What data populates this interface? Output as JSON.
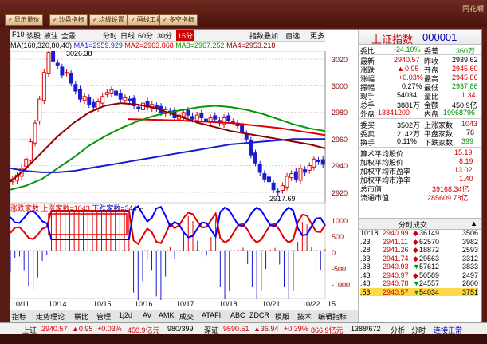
{
  "brand": "同花顺",
  "top_buttons": [
    "显示量价",
    "沙盘指标",
    "均线设置",
    "画线工具",
    "多空指标",
    "大盘对比"
  ],
  "toolbar": {
    "items": [
      "F10",
      "诊股",
      "披注",
      "全景",
      "分时",
      "日线",
      "60分",
      "30分",
      "15分",
      "1分"
    ],
    "active": "15分",
    "right": [
      "指数叠加",
      "自选",
      "更多"
    ]
  },
  "ma_line": {
    "label": "MA",
    "params": "(160,320,80,40)",
    "ma1": "MA1=2959.929",
    "ma2": "MA2=2963.868",
    "ma3": "MA3=2967.252",
    "ma4": "MA4=2953.218"
  },
  "price_axis": [
    "3020",
    "3000",
    "2980",
    "2960",
    "2940",
    "2920"
  ],
  "annotations": {
    "high": "3026.38",
    "low": "2917.69"
  },
  "indicator_label": {
    "name": "涨跌家数",
    "up": "上涨家数=1043",
    "down": "下跌家数=344",
    "dash": "--"
  },
  "indicator_axis": [
    "1000",
    "500",
    "0",
    "-500",
    "-1000"
  ],
  "x_axis": [
    "10/11",
    "10/14",
    "10/15",
    "10/16",
    "10/17",
    "10/18",
    "10/21",
    "10/22"
  ],
  "x_axis_btn": "15分钟",
  "colors": {
    "ma1": "#1a1ad0",
    "ma2": "#e00000",
    "ma3": "#009900",
    "ma4": "#8b0000",
    "up": "#e00000",
    "down": "#0000ff",
    "bg": "#5a1a14"
  },
  "quote": {
    "title": "上证指数",
    "code": "000001",
    "委比": "-24.10%",
    "委差": "1360万",
    "最新": "2940.57",
    "昨收": "2939.62",
    "涨跌": "0.95",
    "开盘": "2945.60",
    "涨幅": "+0.03%",
    "最高": "2945.86",
    "振幅": "0.27%",
    "最低": "2937.86",
    "现手": "54034",
    "量比": "1.34",
    "总手": "3881万",
    "金额": "450.9亿",
    "外盘": "18841200",
    "内盘": "19968796",
    "委买": "3502万",
    "上涨家数": "1043",
    "委卖": "2142万",
    "平盘家数": "76",
    "换手": "0.11%",
    "下跌家数": "399",
    "算术平均股价": "15.19",
    "加权平均股价": "8.19",
    "加权平均市盈率": "13.02",
    "加权平均市净率": "1.40",
    "总市值": "39168.34亿",
    "流通市值": "285609.78亿"
  },
  "tick_head": {
    "title": "分时成交",
    "nav": "▲"
  },
  "ticks": [
    {
      "t": "10:18",
      "p": "2940.99",
      "f": "◆",
      "v1": "36149",
      "v2": "3506"
    },
    {
      "t": ".23",
      "p": "2941.11",
      "f": "◆",
      "v1": "62570",
      "v2": "3982"
    },
    {
      "t": ".28",
      "p": "2941.26",
      "f": "◆",
      "v1": "18872",
      "v2": "2593"
    },
    {
      "t": ".33",
      "p": "2941.74",
      "f": "◆",
      "v1": "29563",
      "v2": "3312"
    },
    {
      "t": ".38",
      "p": "2940.93",
      "f": "▼",
      "v1": "57612",
      "v2": "3833"
    },
    {
      "t": ".43",
      "p": "2940.97",
      "f": "◆",
      "v1": "50589",
      "v2": "2497"
    },
    {
      "t": ".48",
      "p": "2940.78",
      "f": "▼",
      "v1": "24557",
      "v2": "2800"
    },
    {
      "t": ".53",
      "p": "2940.57",
      "f": "▼",
      "v1": "54034",
      "v2": "3751"
    }
  ],
  "rp_bottom": [
    "笔",
    "价",
    "分",
    "多",
    "细"
  ],
  "tabs": [
    "指标",
    "走势理论",
    "横比",
    "管理",
    "1j2d",
    "AV",
    "AMK",
    "成交",
    "ATAFI",
    "ABC",
    "ZDCR",
    "模版",
    "技术",
    "编辑指标"
  ],
  "status": {
    "idx1": "上证",
    "p1": "2940.57",
    "c1": "▲0.95",
    "r1": "+0.03%",
    "a1": "450.9亿元",
    "v1": "980/399",
    "idx2": "深证",
    "p2": "9590.51",
    "c2": "▲36.94",
    "r2": "+0.39%",
    "a2": "866.9亿元",
    "v2": "1388/672",
    "right1": "分析",
    "right2": "分时",
    "right3": "连接正常"
  }
}
